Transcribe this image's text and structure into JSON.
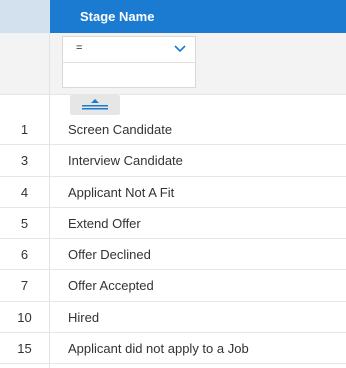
{
  "header": {
    "column_title": "Stage Name"
  },
  "filter": {
    "operator": "=",
    "value": ""
  },
  "rows": [
    {
      "id": "1",
      "name": "Screen Candidate"
    },
    {
      "id": "3",
      "name": "Interview Candidate"
    },
    {
      "id": "4",
      "name": "Applicant Not A Fit"
    },
    {
      "id": "5",
      "name": "Extend Offer"
    },
    {
      "id": "6",
      "name": "Offer Declined"
    },
    {
      "id": "7",
      "name": "Offer Accepted"
    },
    {
      "id": "10",
      "name": "Hired"
    },
    {
      "id": "15",
      "name": "Applicant did not apply to a Job"
    }
  ],
  "colors": {
    "header_blue": "#1a7bd1",
    "header_num_bg": "#d3e0ee",
    "filter_bg": "#f3f3f3"
  }
}
